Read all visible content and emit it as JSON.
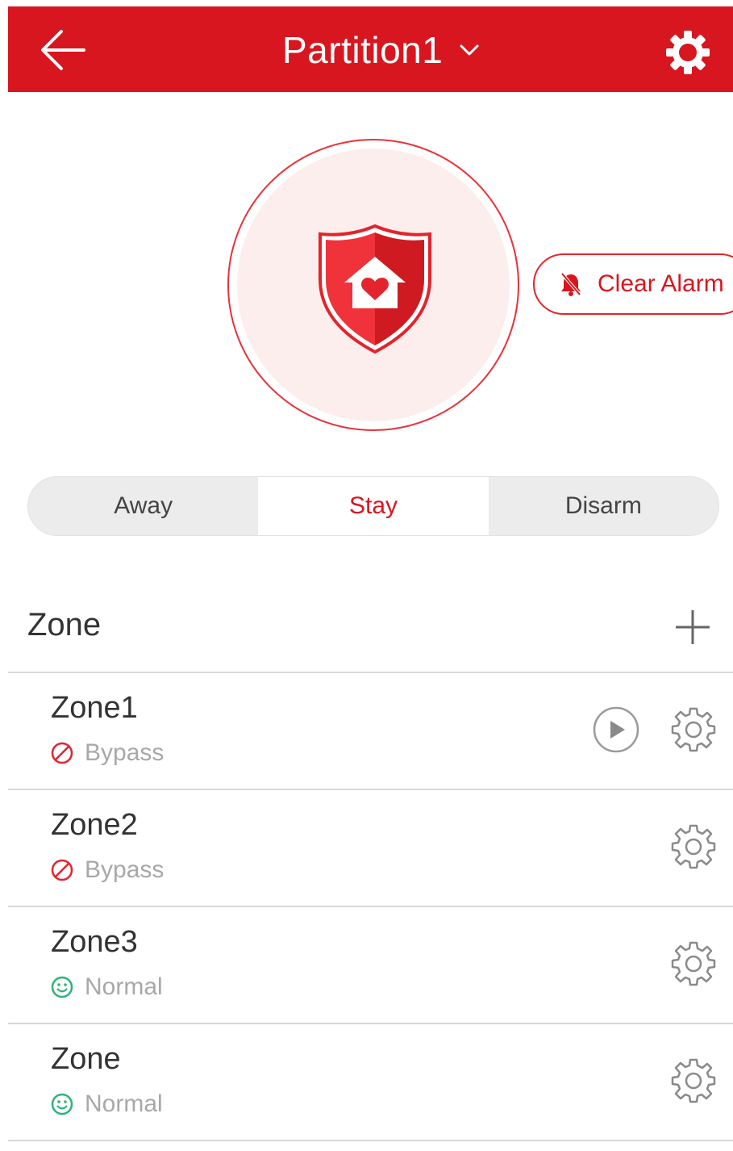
{
  "header": {
    "title": "Partition1",
    "back_icon": "back-arrow-icon",
    "dropdown_icon": "chevron-down-icon",
    "settings_icon": "gear-icon",
    "bg_color": "#d8161f"
  },
  "status_graphic": {
    "icon": "shield-home-heart-icon"
  },
  "clear_alarm": {
    "label": "Clear Alarm",
    "icon": "bell-off-icon"
  },
  "modes": [
    {
      "label": "Away",
      "active": false
    },
    {
      "label": "Stay",
      "active": true
    },
    {
      "label": "Disarm",
      "active": false
    }
  ],
  "zone_section": {
    "title": "Zone",
    "add_icon": "plus-icon"
  },
  "zones": [
    {
      "name": "Zone1",
      "status": "Bypass",
      "status_icon": "bypass-icon",
      "has_play": true
    },
    {
      "name": "Zone2",
      "status": "Bypass",
      "status_icon": "bypass-icon",
      "has_play": false
    },
    {
      "name": "Zone3",
      "status": "Normal",
      "status_icon": "smile-icon",
      "has_play": false
    },
    {
      "name": "Zone",
      "status": "Normal",
      "status_icon": "smile-icon",
      "has_play": false
    }
  ],
  "colors": {
    "accent": "#d8161f",
    "normal_green": "#2db37a",
    "muted_text": "#a8a8a8"
  }
}
